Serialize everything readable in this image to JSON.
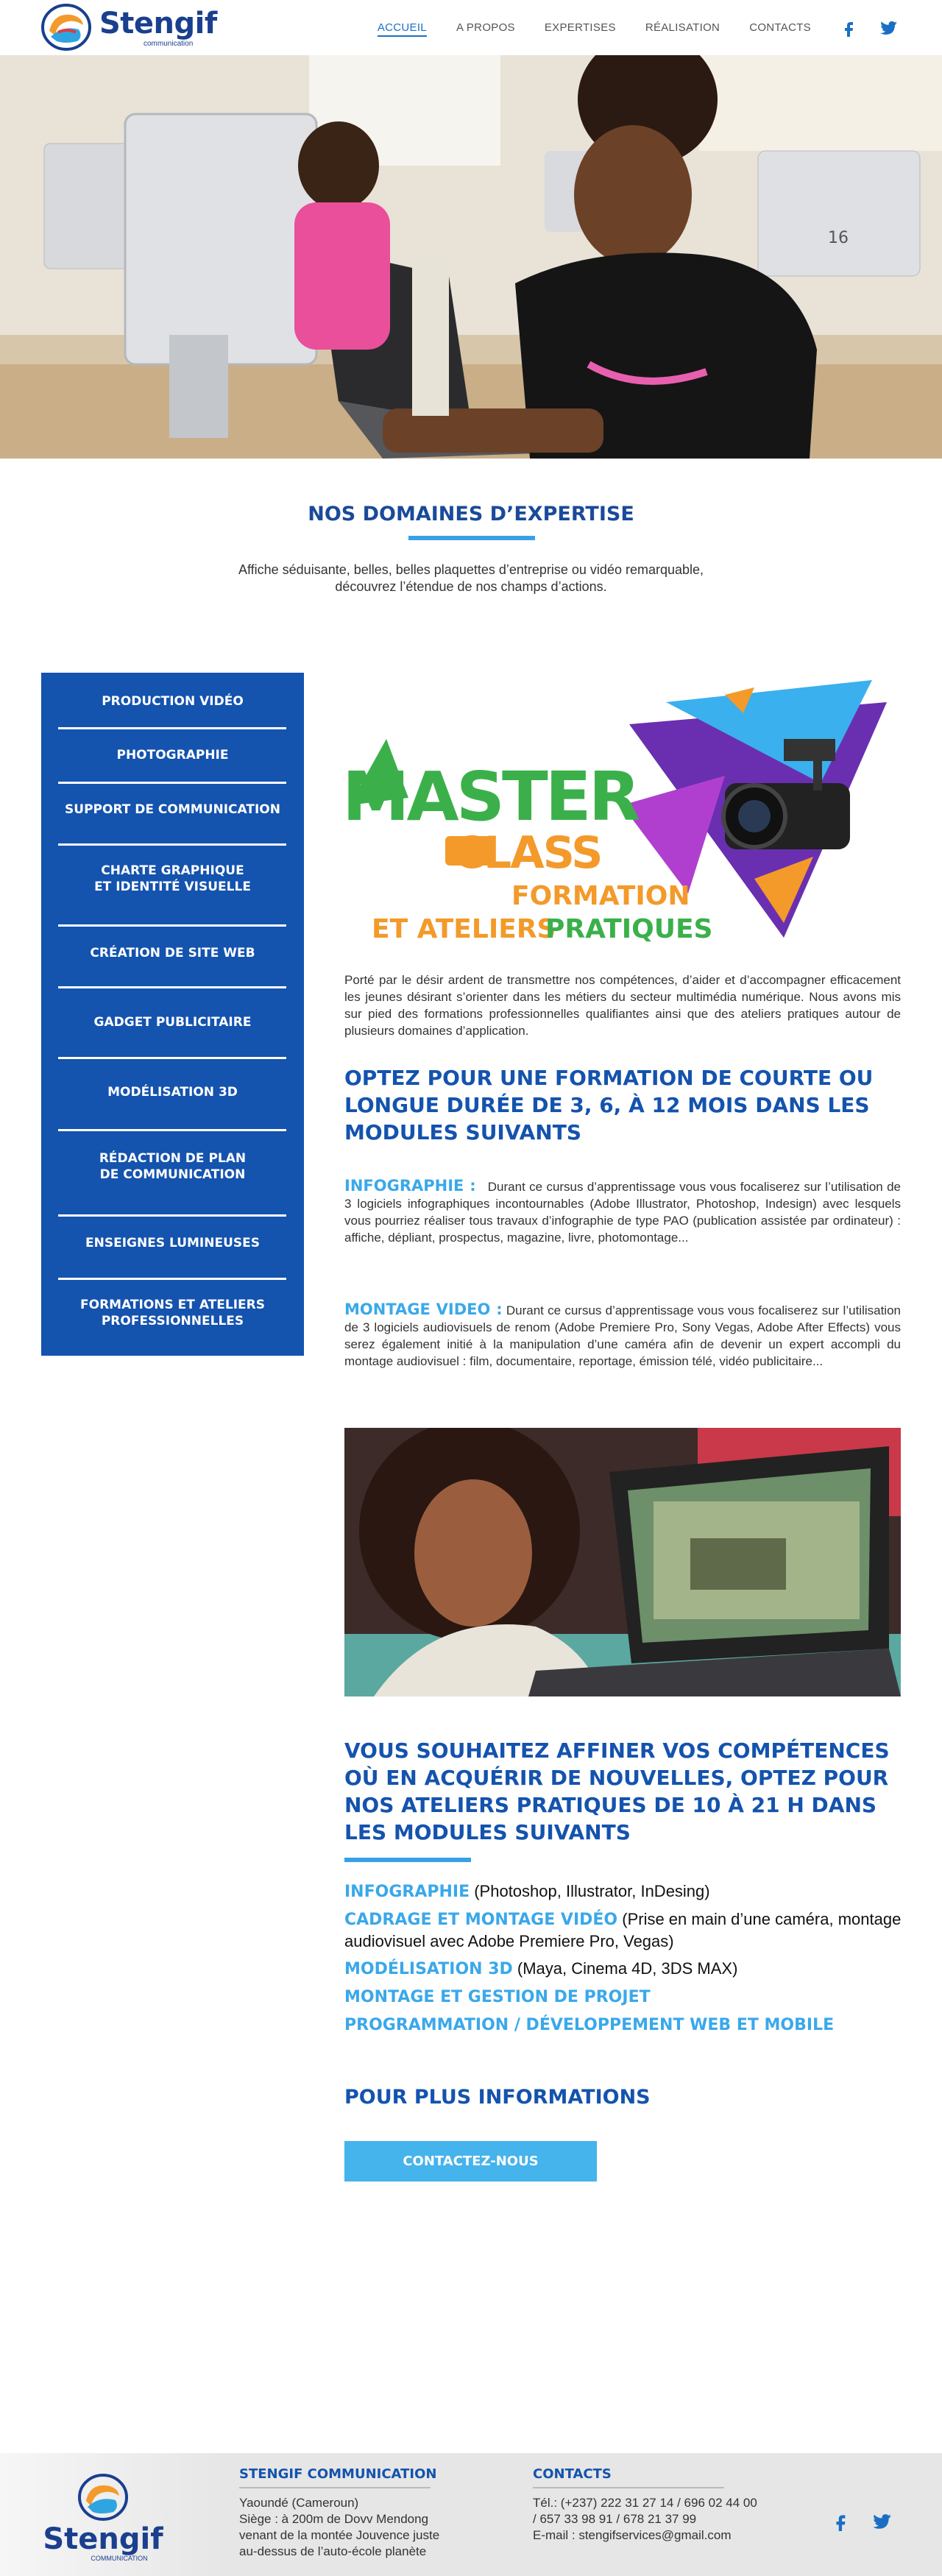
{
  "brand": {
    "name": "Stengif",
    "sub": "communication"
  },
  "nav": {
    "items": [
      "ACCUEIL",
      "A PROPOS",
      "EXPERTISES",
      "RÉALISATION",
      "CONTACTS"
    ],
    "active": "ACCUEIL"
  },
  "social": {
    "icons": [
      "facebook-icon",
      "twitter-icon"
    ],
    "color": "#1a6fc4"
  },
  "expertise": {
    "title": "NOS DOMAINES D’EXPERTISE",
    "intro": "Affiche séduisante, belles, belles plaquettes d’entreprise ou vidéo remarquable, découvrez l’étendue de nos champs d’actions."
  },
  "sidebar": {
    "items": [
      "PRODUCTION VIDÉO",
      "PHOTOGRAPHIE",
      "SUPPORT DE COMMUNICATION",
      "CHARTE GRAPHIQUE\nET IDENTITÉ VISUELLE",
      "CRÉATION DE SITE WEB",
      "GADGET PUBLICITAIRE",
      "MODÉLISATION 3D",
      "RÉDACTION DE PLAN\nDE COMMUNICATION",
      "ENSEIGNES LUMINEUSES",
      "FORMATIONS ET ATELIERS\nPROFESSIONNELLES"
    ]
  },
  "masterclass": {
    "word1": "MASTER",
    "word2": "CLASS",
    "line1": "FORMATION",
    "line2a": "ET ATELIERS",
    "line2b": "PRATIQUES"
  },
  "content": {
    "intro": "Porté par le désir ardent de transmettre nos compétences, d’aider et d’accompagner efficacement les jeunes désirant s’orienter dans les métiers du secteur multimédia numérique. Nous avons mis sur pied des formations professionnelles qualifiantes ainsi que des ateliers pratiques autour de plusieurs domaines d’application.",
    "heading1": "OPTEZ POUR UNE FORMATION DE COURTE OU LONGUE DURÉE DE 3, 6, À 12 MOIS DANS LES MODULES SUIVANTS",
    "infographie_kw": "INFOGRAPHIE :",
    "infographie_text": "Durant ce cursus d’apprentissage vous vous focaliserez sur l’utilisation de 3 logiciels infographiques incontournables (Adobe Illustrator, Photoshop, Indesign) avec lesquels vous pourriez réaliser tous travaux d’infographie de type PAO (publication assistée par ordinateur) : affiche, dépliant, prospectus, magazine, livre, photomontage...",
    "montage_kw": "MONTAGE VIDEO :",
    "montage_text": "Durant ce cursus d’apprentissage vous vous focaliserez sur l’utilisation de 3 logiciels audiovisuels de renom (Adobe Premiere Pro, Sony Vegas, Adobe After Effects) vous serez également initié à la manipulation d’une caméra afin de devenir un expert accompli du montage audiovisuel : film, documentaire, reportage, émission télé, vidéo publicitaire...",
    "heading2": "VOUS SOUHAITEZ AFFINER VOS COMPÉTENCES OÙ EN ACQUÉRIR DE NOUVELLES, OPTEZ POUR NOS ATELIERS PRATIQUES DE 10 À 21 H DANS LES MODULES SUIVANTS",
    "modules": [
      {
        "kw": "INFOGRAPHIE",
        "text": " (Photoshop, Illustrator, InDesing)"
      },
      {
        "kw": "CADRAGE ET MONTAGE VIDÉO",
        "text": " (Prise en main d’une caméra, montage audiovisuel avec Adobe Premiere Pro, Vegas)"
      },
      {
        "kw": "MODÉLISATION 3D",
        "text": " (Maya, Cinema 4D, 3DS MAX)"
      },
      {
        "kw": "MONTAGE ET GESTION DE PROJET",
        "text": ""
      },
      {
        "kw": "PROGRAMMATION / DÉVELOPPEMENT WEB ET MOBILE",
        "text": ""
      }
    ],
    "more_title": "POUR PLUS INFORMATIONS",
    "cta": "CONTACTEZ-NOUS"
  },
  "footer": {
    "brand": "Stengif",
    "brand_sub": "COMMUNICATION",
    "company_title": "STENGIF COMMUNICATION",
    "company_lines": [
      "Yaoundé (Cameroun)",
      "Siège : à 200m de Dovv Mendong",
      "venant de la montée Jouvence juste",
      "au-dessus de l’auto-école planète"
    ],
    "contacts_title": "CONTACTS",
    "contacts_lines": [
      "Tél.: (+237) 222 31 27 14 / 696 02 44 00",
      "/ 657 33 98 91 / 678 21 37 99",
      "E-mail : stengifservices@gmail.com"
    ]
  },
  "colors": {
    "primary": "#1453ae",
    "accent": "#3aa8ea",
    "nav_active": "#1a6fc4"
  }
}
